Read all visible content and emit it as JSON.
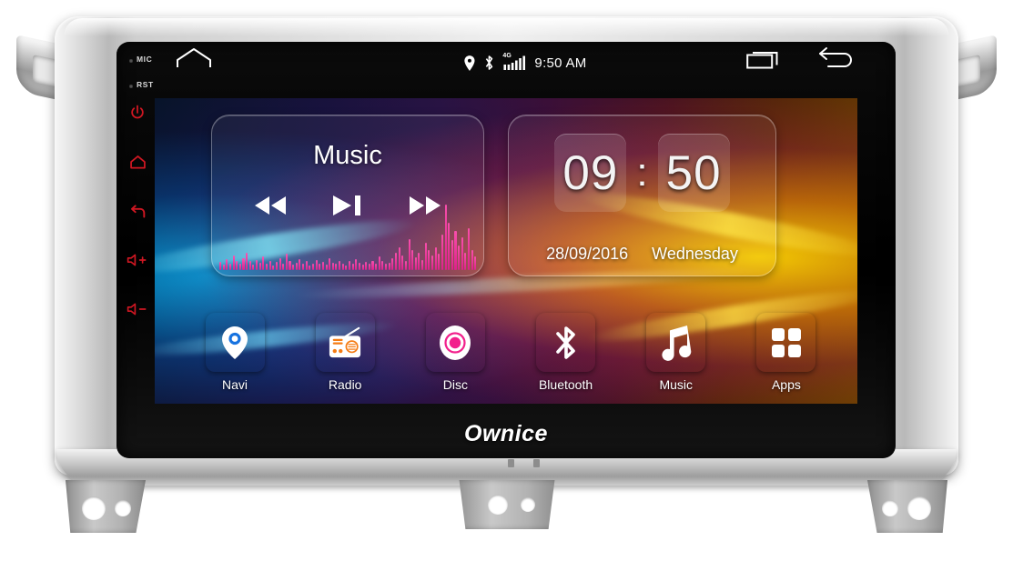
{
  "device": {
    "brand": "Ownice",
    "hard_keys": [
      {
        "name": "mic",
        "label": "MIC",
        "type": "text"
      },
      {
        "name": "reset",
        "label": "RST",
        "type": "text"
      },
      {
        "name": "power",
        "label": "power-icon",
        "type": "icon"
      },
      {
        "name": "home",
        "label": "home-icon",
        "type": "icon"
      },
      {
        "name": "back",
        "label": "back-icon",
        "type": "icon"
      },
      {
        "name": "volume-up",
        "label": "volume-up-icon",
        "type": "icon"
      },
      {
        "name": "volume-down",
        "label": "volume-down-icon",
        "type": "icon"
      }
    ],
    "key_accent_color": "#d01722"
  },
  "statusbar": {
    "home_icon": "home-icon",
    "location_icon": "location-pin-icon",
    "bluetooth_icon": "bluetooth-icon",
    "network_label": "4G",
    "signal_icon": "signal-bars-icon",
    "time": "9:50 AM",
    "recent_icon": "recent-apps-icon",
    "back_icon": "back-arrow-icon"
  },
  "music_widget": {
    "title": "Music",
    "prev_label": "previous-track",
    "play_label": "play-pause",
    "next_label": "next-track",
    "equalizer_bars": [
      12,
      8,
      16,
      10,
      22,
      14,
      9,
      18,
      26,
      13,
      8,
      15,
      11,
      20,
      9,
      14,
      7,
      12,
      18,
      10,
      24,
      13,
      8,
      11,
      16,
      9,
      13,
      7,
      10,
      15,
      9,
      12,
      8,
      18,
      11,
      9,
      14,
      10,
      7,
      13,
      9,
      16,
      11,
      8,
      12,
      9,
      14,
      10,
      20,
      13,
      9,
      11,
      17,
      25,
      33,
      22,
      14,
      46,
      30,
      19,
      26,
      15,
      40,
      29,
      21,
      34,
      24,
      52,
      96,
      70,
      44,
      58,
      36,
      48,
      26,
      62,
      30,
      20
    ],
    "accent_color": "#ff4fb0"
  },
  "clock_widget": {
    "hours": "09",
    "separator": ":",
    "minutes": "50",
    "date": "28/09/2016",
    "weekday": "Wednesday"
  },
  "dock": {
    "apps": [
      {
        "label": "Navi",
        "icon": "map-pin-icon",
        "color": "#1773e0"
      },
      {
        "label": "Radio",
        "icon": "radio-icon",
        "color": "#f57c13"
      },
      {
        "label": "Disc",
        "icon": "disc-icon",
        "color": "#f2208c"
      },
      {
        "label": "Bluetooth",
        "icon": "bluetooth-icon",
        "color": "#1773e0"
      },
      {
        "label": "Music",
        "icon": "music-note-icon",
        "color": "#e8383c"
      },
      {
        "label": "Apps",
        "icon": "grid-apps-icon",
        "color": "#8a8a8a"
      }
    ]
  }
}
